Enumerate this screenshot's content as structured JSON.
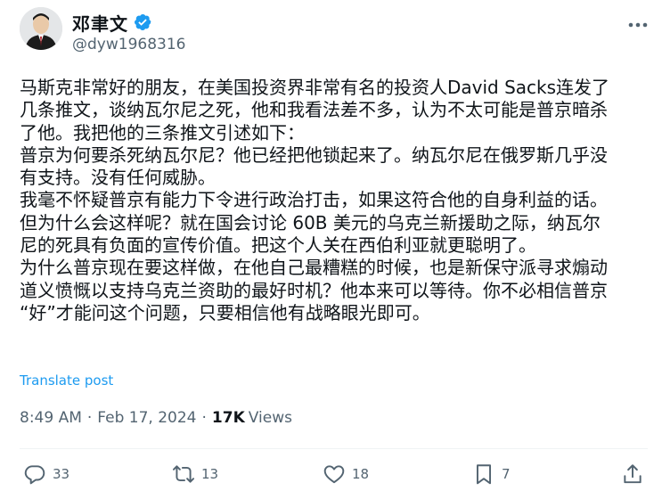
{
  "author": {
    "display_name": "邓聿文",
    "handle": "@dyw1968316"
  },
  "tweet": {
    "lines": [
      "马斯克非常好的朋友，在美国投资界非常有名的投资人David Sacks连发了",
      "几条推文，谈纳瓦尔尼之死，他和我看法差不多，认为不太可能是普京暗杀",
      "了他。我把他的三条推文引述如下：",
      "普京为何要杀死纳瓦尔尼？他已经把他锁起来了。纳瓦尔尼在俄罗斯几乎没",
      "有支持。没有任何威胁。",
      "我毫不怀疑普京有能力下令进行政治打击，如果这符合他的自身利益的话。",
      "但为什么会这样呢？就在国会讨论 60B 美元的乌克兰新援助之际，纳瓦尔",
      "尼的死具有负面的宣传价值。把这个人关在西伯利亚就更聪明了。",
      "为什么普京现在要这样做，在他自己最糟糕的时候，也是新保守派寻求煽动",
      "道义愤慨以支持乌克兰资助的最好时机？他本来可以等待。你不必相信普京",
      "“好”才能问这个问题，只要相信他有战略眼光即可。"
    ],
    "translate_label": "Translate post"
  },
  "meta": {
    "time": "8:49 AM",
    "separator": "·",
    "date": "Feb 17, 2024",
    "views_count": "17K",
    "views_label": "Views"
  },
  "actions": {
    "replies": "33",
    "reposts": "13",
    "likes": "18",
    "bookmarks": "7"
  },
  "colors": {
    "accent": "#1d9bf0",
    "secondary_text": "#536471",
    "primary_text": "#0f1419"
  }
}
